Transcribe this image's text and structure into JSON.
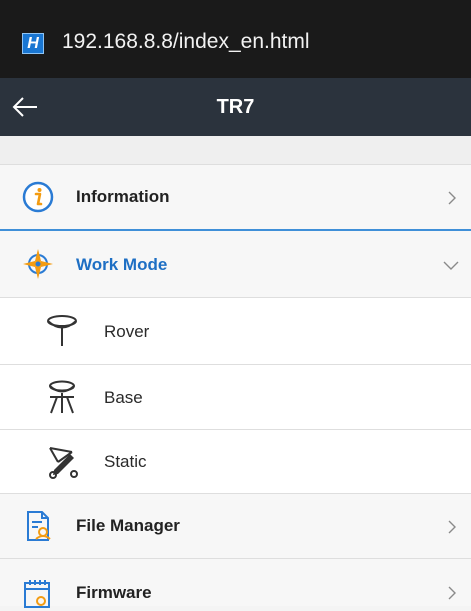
{
  "browser": {
    "badge_letter": "H",
    "url": "192.168.8.8/index_en.html"
  },
  "navbar": {
    "title": "TR7",
    "back_icon": "arrow-left-icon"
  },
  "menu": {
    "information": {
      "label": "Information",
      "icon": "info-circle-icon"
    },
    "work_mode": {
      "label": "Work Mode",
      "icon": "compass-icon",
      "expanded": true,
      "accent_color": "#1e6fc4",
      "items": [
        {
          "label": "Rover",
          "icon": "rover-antenna-icon"
        },
        {
          "label": "Base",
          "icon": "base-tripod-icon"
        },
        {
          "label": "Static",
          "icon": "static-survey-icon"
        }
      ]
    },
    "file_manager": {
      "label": "File Manager",
      "icon": "file-search-icon"
    },
    "firmware": {
      "label": "Firmware",
      "icon": "firmware-calendar-icon"
    }
  }
}
